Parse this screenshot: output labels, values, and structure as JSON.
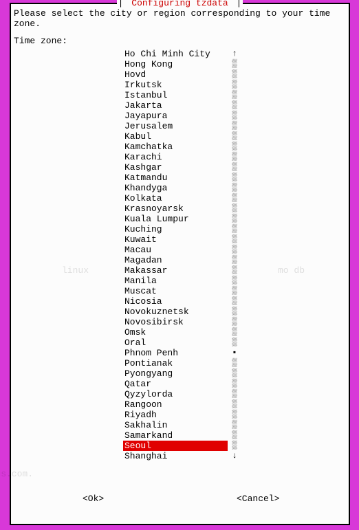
{
  "title": "Configuring tzdata",
  "pipe": "|",
  "prompt": "Please select the city or region corresponding to your time zone.",
  "field_label": "Time zone:",
  "selected_index": 38,
  "items": [
    "Ho Chi Minh City",
    "Hong Kong",
    "Hovd",
    "Irkutsk",
    "Istanbul",
    "Jakarta",
    "Jayapura",
    "Jerusalem",
    "Kabul",
    "Kamchatka",
    "Karachi",
    "Kashgar",
    "Katmandu",
    "Khandyga",
    "Kolkata",
    "Krasnoyarsk",
    "Kuala Lumpur",
    "Kuching",
    "Kuwait",
    "Macau",
    "Magadan",
    "Makassar",
    "Manila",
    "Muscat",
    "Nicosia",
    "Novokuznetsk",
    "Novosibirsk",
    "Omsk",
    "Oral",
    "Phnom Penh",
    "Pontianak",
    "Pyongyang",
    "Qatar",
    "Qyzylorda",
    "Rangoon",
    "Riyadh",
    "Sakhalin",
    "Samarkand",
    "Seoul",
    "Shanghai"
  ],
  "scroll_top_arrow": "↑",
  "scroll_bottom_arrow": "↓",
  "scroll_track": "▒",
  "scroll_thumb": "▪",
  "thumb_index": 29,
  "buttons": {
    "ok": "<Ok>",
    "cancel": "<Cancel>"
  },
  "watermark_left": "linux",
  "watermark_right": "mo    db",
  "watermark_bl": "blogs.com."
}
